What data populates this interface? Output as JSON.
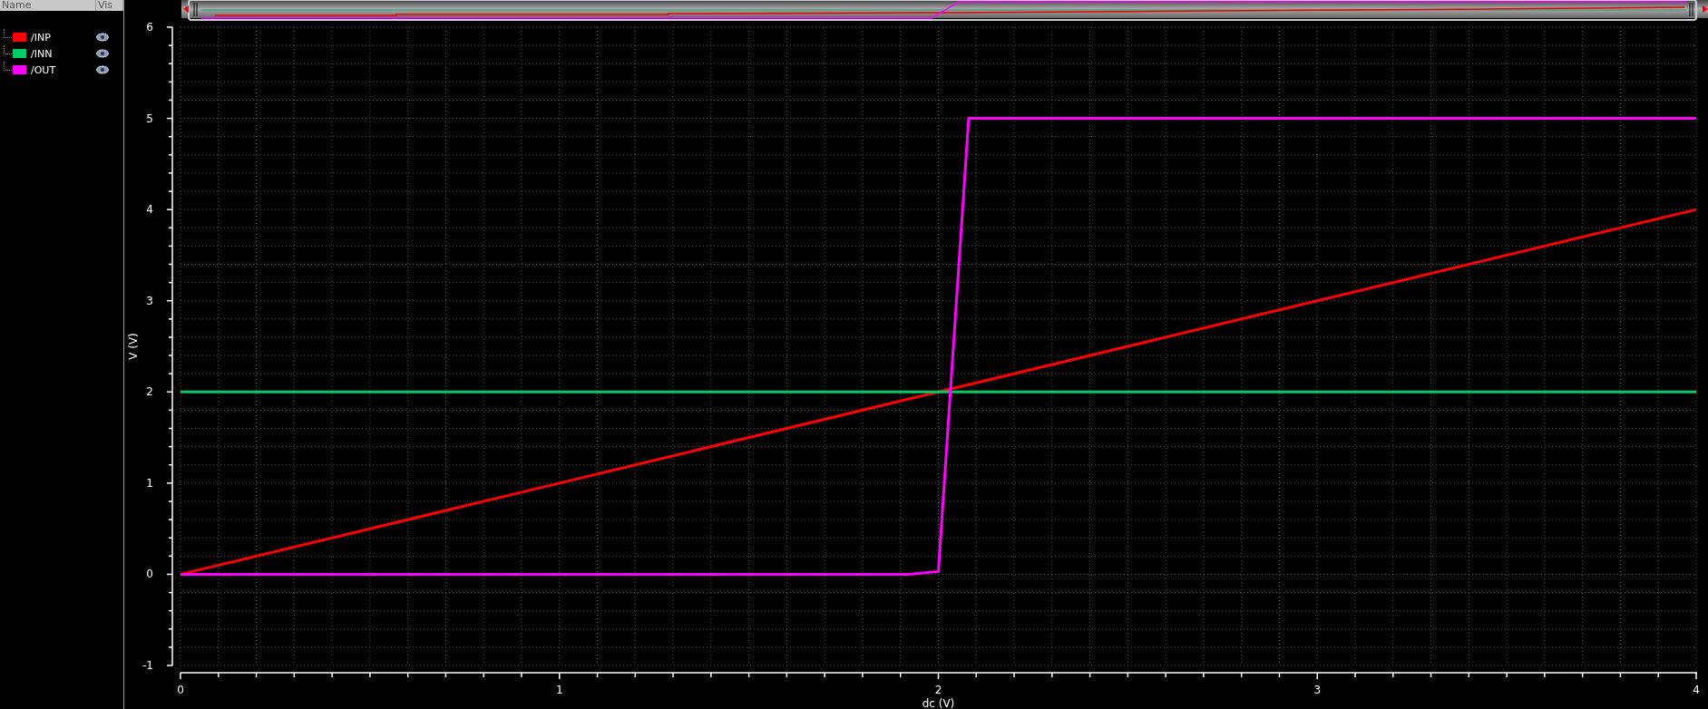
{
  "legend": {
    "columns": [
      "Name",
      "Vis"
    ],
    "signals": [
      {
        "visible": true
      },
      {
        "visible": true
      },
      {
        "visible": true
      }
    ]
  },
  "plot": {
    "chart_data": {
      "type": "line",
      "xlabel": "dc (V)",
      "ylabel": "V (V)",
      "grid": true,
      "x": [
        0,
        1,
        1.92,
        2,
        2.08,
        3,
        4
      ],
      "series": [
        {
          "name": "/INP",
          "color": "#ff0000",
          "values": [
            0,
            1,
            1.92,
            2,
            2.08,
            3,
            4
          ]
        },
        {
          "name": "/INN",
          "color": "#00cc66",
          "values": [
            2,
            2,
            2,
            2,
            2,
            2,
            2
          ]
        },
        {
          "name": "/OUT",
          "color": "#ff00ff",
          "values": [
            0,
            0,
            0,
            0.03,
            5,
            5,
            5
          ]
        }
      ],
      "xlim": [
        0,
        4
      ],
      "ylim": [
        -1,
        6
      ],
      "xticks": [
        0,
        1,
        2,
        3,
        4
      ],
      "yticks": [
        -1,
        0,
        1,
        2,
        3,
        4,
        5,
        6
      ]
    }
  }
}
